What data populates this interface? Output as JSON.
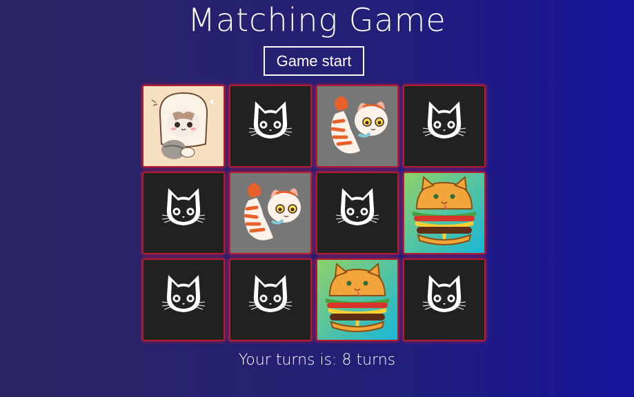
{
  "title": "Matching Game",
  "start_button": "Game start",
  "turns": {
    "prefix": "Your turns is: ",
    "count": "8",
    "suffix": " turns"
  },
  "cards": [
    {
      "state": "face-up",
      "image": "bread-cat"
    },
    {
      "state": "face-down",
      "image": "cat-silhouette"
    },
    {
      "state": "face-up",
      "image": "shrimp-cat"
    },
    {
      "state": "face-down",
      "image": "cat-silhouette"
    },
    {
      "state": "face-down",
      "image": "cat-silhouette"
    },
    {
      "state": "face-up",
      "image": "shrimp-cat"
    },
    {
      "state": "face-down",
      "image": "cat-silhouette"
    },
    {
      "state": "face-up",
      "image": "burger-cat"
    },
    {
      "state": "face-down",
      "image": "cat-silhouette"
    },
    {
      "state": "face-down",
      "image": "cat-silhouette"
    },
    {
      "state": "face-up",
      "image": "burger-cat"
    },
    {
      "state": "face-down",
      "image": "cat-silhouette"
    }
  ],
  "colors": {
    "card_border": "#b51d2c",
    "card_back": "#222122"
  }
}
